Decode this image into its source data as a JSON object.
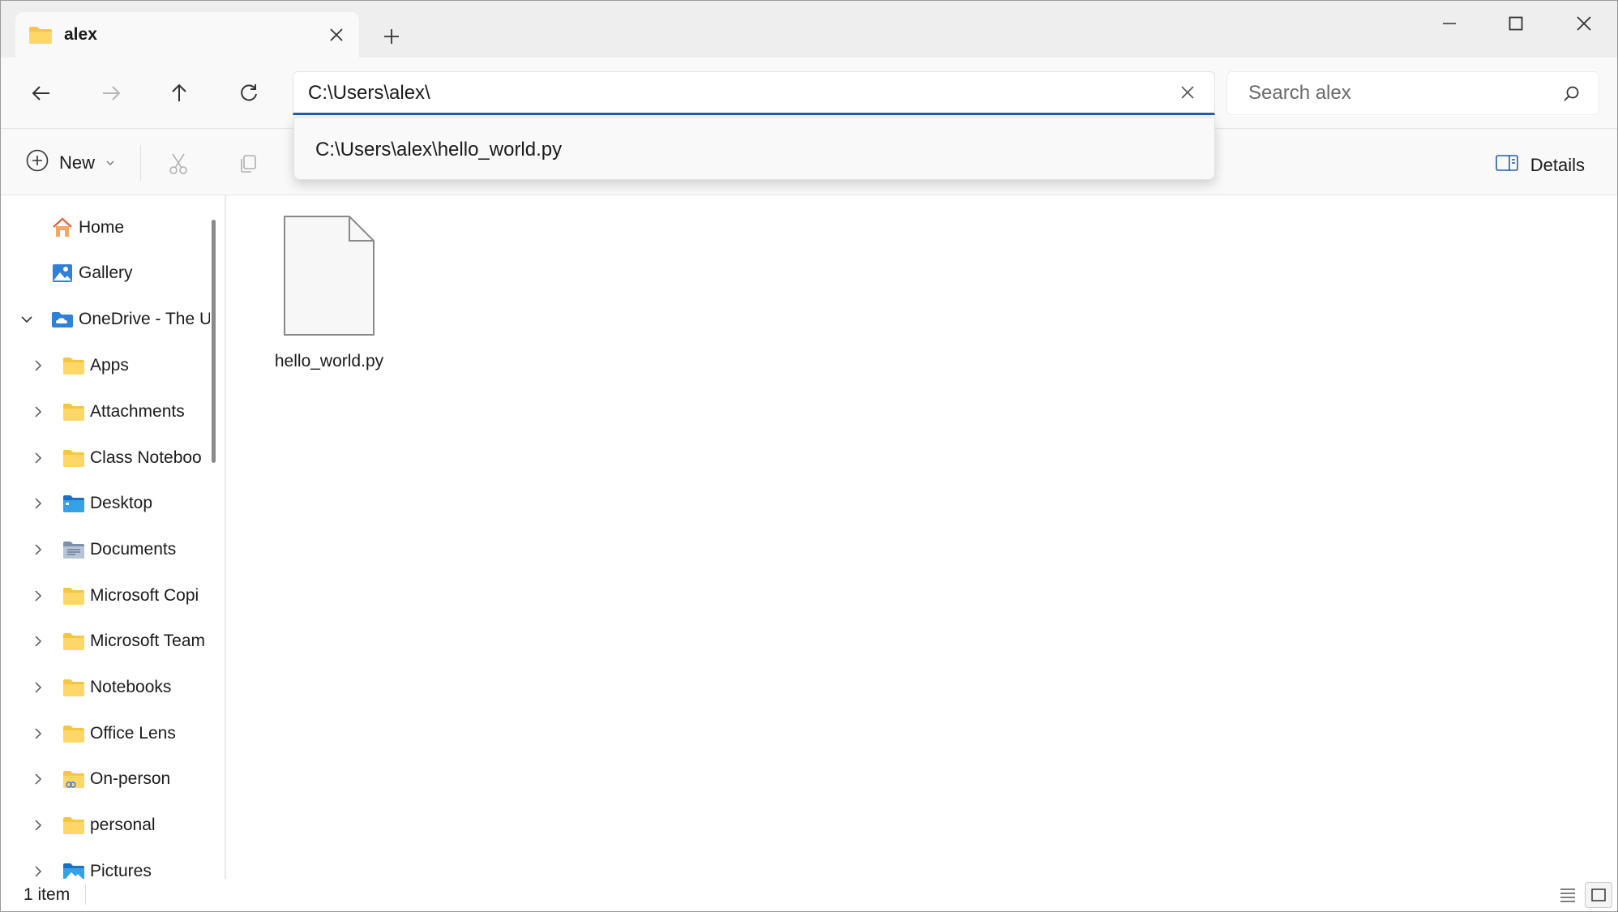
{
  "window": {
    "tab_title": "alex",
    "new_tab_symbol": "+"
  },
  "address": {
    "path": "C:\\Users\\alex\\",
    "search_placeholder": "Search alex"
  },
  "suggestion": {
    "item": "C:\\Users\\alex\\hello_world.py"
  },
  "toolbar": {
    "new_label": "New",
    "details_label": "Details"
  },
  "sidebar": {
    "items": [
      {
        "label": "Home",
        "icon": "home-icon"
      },
      {
        "label": "Gallery",
        "icon": "gallery-icon"
      },
      {
        "label": "OneDrive - The U",
        "icon": "onedrive-icon"
      },
      {
        "label": "Apps",
        "icon": "folder-icon"
      },
      {
        "label": "Attachments",
        "icon": "folder-icon"
      },
      {
        "label": "Class Noteboo",
        "icon": "folder-icon"
      },
      {
        "label": "Desktop",
        "icon": "desktop-folder-icon"
      },
      {
        "label": "Documents",
        "icon": "documents-folder-icon"
      },
      {
        "label": "Microsoft Copi",
        "icon": "folder-icon"
      },
      {
        "label": "Microsoft Team",
        "icon": "folder-icon"
      },
      {
        "label": "Notebooks",
        "icon": "folder-icon"
      },
      {
        "label": "Office Lens",
        "icon": "folder-icon"
      },
      {
        "label": "On-person",
        "icon": "shared-folder-icon"
      },
      {
        "label": "personal",
        "icon": "folder-icon"
      },
      {
        "label": "Pictures",
        "icon": "pictures-folder-icon"
      }
    ]
  },
  "files": [
    {
      "name": "hello_world.py",
      "icon": "generic-file-icon"
    }
  ],
  "status": {
    "count": "1 item"
  },
  "colors": {
    "accent": "#1f5fad",
    "folder": "#f6c643",
    "onedrive": "#2f80d7"
  }
}
